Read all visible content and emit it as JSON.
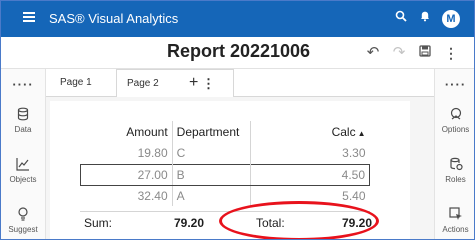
{
  "app": {
    "title": "SAS® Visual Analytics",
    "user_initial": "M"
  },
  "report": {
    "title": "Report 20221006"
  },
  "left_rail": {
    "dots": "····",
    "items": [
      {
        "label": "Data",
        "icon": "database-icon"
      },
      {
        "label": "Objects",
        "icon": "chart-icon"
      },
      {
        "label": "Suggest",
        "icon": "lightbulb-icon"
      }
    ]
  },
  "right_rail": {
    "dots": "····",
    "items": [
      {
        "label": "Options",
        "icon": "options-icon"
      },
      {
        "label": "Roles",
        "icon": "roles-icon"
      },
      {
        "label": "Actions",
        "icon": "actions-icon"
      }
    ]
  },
  "tabs": {
    "page1": "Page 1",
    "page2": "Page 2",
    "kebab": "⋮",
    "add": "+"
  },
  "table": {
    "headers": {
      "amount": "Amount",
      "department": "Department",
      "calc": "Calc"
    },
    "sort_indicator": "▲",
    "rows": [
      {
        "amount": "19.80",
        "department": "C",
        "calc": "3.30"
      },
      {
        "amount": "27.00",
        "department": "B",
        "calc": "4.50"
      },
      {
        "amount": "32.40",
        "department": "A",
        "calc": "5.40"
      }
    ],
    "sum_label": "Sum:",
    "sum_value": "79.20",
    "total_label": "Total:",
    "total_value": "79.20"
  },
  "colors": {
    "appbar": "#1566b8",
    "highlight": "#e8121c"
  }
}
